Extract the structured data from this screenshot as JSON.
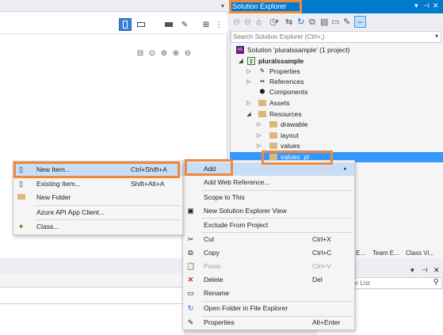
{
  "solution_explorer": {
    "title": "Solution Explorer",
    "title_controls": {
      "dropdown": "▾",
      "pin": "⊣",
      "close": "✕"
    },
    "search_placeholder": "Search Solution Explorer (Ctrl+;)",
    "tree": [
      {
        "label": "Solution 'pluralssample' (1 project)",
        "icon": "solution-icon"
      },
      {
        "label": "pluralssample",
        "icon": "project-icon"
      },
      {
        "label": "Properties",
        "icon": "wrench-icon"
      },
      {
        "label": "References",
        "icon": "references-icon"
      },
      {
        "label": "Components",
        "icon": "components-icon"
      },
      {
        "label": "Assets",
        "icon": "folder-icon"
      },
      {
        "label": "Resources",
        "icon": "folder-icon"
      },
      {
        "label": "drawable",
        "icon": "folder-icon"
      },
      {
        "label": "layout",
        "icon": "folder-icon"
      },
      {
        "label": "values",
        "icon": "folder-icon"
      },
      {
        "label": "values_pl",
        "icon": "folder-icon"
      }
    ],
    "bottom_tabs": [
      "E...",
      "Team E...",
      "Class Vi..."
    ]
  },
  "lower_right": {
    "search_placeholder": "or List"
  },
  "context_menu": {
    "items": [
      {
        "label": "Add",
        "shortcut": "",
        "icon": "",
        "submenu": "▸"
      },
      {
        "label": "Add Web Reference...",
        "shortcut": "",
        "icon": ""
      },
      {
        "label": "Scope to This",
        "shortcut": "",
        "icon": ""
      },
      {
        "label": "New Solution Explorer View",
        "shortcut": "",
        "icon": "new-view-icon"
      },
      {
        "label": "Exclude From Project",
        "shortcut": "",
        "icon": ""
      },
      {
        "label": "Cut",
        "shortcut": "Ctrl+X",
        "icon": "cut-icon"
      },
      {
        "label": "Copy",
        "shortcut": "Ctrl+C",
        "icon": "copy-icon"
      },
      {
        "label": "Paste",
        "shortcut": "Ctrl+V",
        "icon": "paste-icon",
        "disabled": true
      },
      {
        "label": "Delete",
        "shortcut": "Del",
        "icon": "delete-icon"
      },
      {
        "label": "Rename",
        "shortcut": "",
        "icon": "rename-icon"
      },
      {
        "label": "Open Folder in File Explorer",
        "shortcut": "",
        "icon": "open-folder-icon"
      },
      {
        "label": "Properties",
        "shortcut": "Alt+Enter",
        "icon": "wrench-icon"
      }
    ]
  },
  "add_submenu": {
    "items": [
      {
        "label": "New Item...",
        "shortcut": "Ctrl+Shift+A",
        "icon": "new-item-icon"
      },
      {
        "label": "Existing Item...",
        "shortcut": "Shift+Alt+A",
        "icon": "existing-item-icon"
      },
      {
        "label": "New Folder",
        "shortcut": "",
        "icon": "new-folder-icon"
      },
      {
        "label": "Azure API App Client...",
        "shortcut": "",
        "icon": ""
      },
      {
        "label": "Class...",
        "shortcut": "",
        "icon": "class-icon"
      }
    ]
  },
  "colors": {
    "accent": "#007acc",
    "selection": "#3399ff",
    "highlight_box": "#f0883e",
    "menu_hover": "#c9def5"
  }
}
